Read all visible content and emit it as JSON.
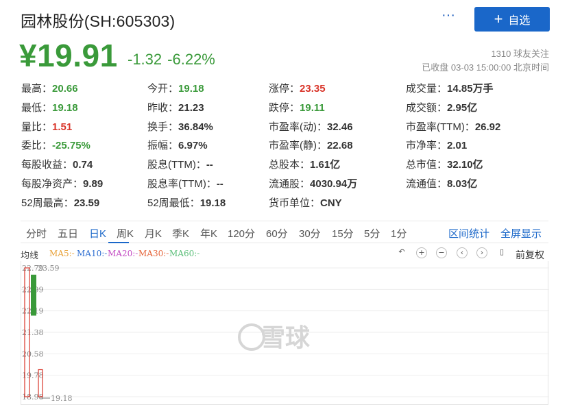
{
  "header": {
    "title": "园林股份(SH:605303)",
    "more_label": "···",
    "follow_label": "自选",
    "follow_plus": "+"
  },
  "quote": {
    "price": "¥19.91",
    "change": "-1.32",
    "change_pct": "-6.22%",
    "followers": "1310 球友关注",
    "status": "已收盘 03-03 15:00:00 北京时间"
  },
  "stats": [
    [
      {
        "label": "最高：",
        "value": "20.66",
        "color": "green"
      },
      {
        "label": "今开：",
        "value": "19.18",
        "color": "green"
      },
      {
        "label": "涨停：",
        "value": "23.35",
        "color": "red"
      },
      {
        "label": "成交量：",
        "value": "14.85万手",
        "color": "dark"
      }
    ],
    [
      {
        "label": "最低：",
        "value": "19.18",
        "color": "green"
      },
      {
        "label": "昨收：",
        "value": "21.23",
        "color": "dark"
      },
      {
        "label": "跌停：",
        "value": "19.11",
        "color": "green"
      },
      {
        "label": "成交额：",
        "value": "2.95亿",
        "color": "dark"
      }
    ],
    [
      {
        "label": "量比：",
        "value": "1.51",
        "color": "red"
      },
      {
        "label": "换手：",
        "value": "36.84%",
        "color": "dark"
      },
      {
        "label": "市盈率(动)：",
        "value": "32.46",
        "color": "dark"
      },
      {
        "label": "市盈率(TTM)：",
        "value": "26.92",
        "color": "dark"
      }
    ],
    [
      {
        "label": "委比：",
        "value": "-25.75%",
        "color": "green"
      },
      {
        "label": "振幅：",
        "value": "6.97%",
        "color": "dark"
      },
      {
        "label": "市盈率(静)：",
        "value": "22.68",
        "color": "dark"
      },
      {
        "label": "市净率：",
        "value": "2.01",
        "color": "dark"
      }
    ],
    [
      {
        "label": "每股收益：",
        "value": "0.74",
        "color": "dark"
      },
      {
        "label": "股息(TTM)：",
        "value": "--",
        "color": "dark"
      },
      {
        "label": "总股本：",
        "value": "1.61亿",
        "color": "dark"
      },
      {
        "label": "总市值：",
        "value": "32.10亿",
        "color": "dark"
      }
    ],
    [
      {
        "label": "每股净资产：",
        "value": "9.89",
        "color": "dark"
      },
      {
        "label": "股息率(TTM)：",
        "value": "--",
        "color": "dark"
      },
      {
        "label": "流通股：",
        "value": "4030.94万",
        "color": "dark"
      },
      {
        "label": "流通值：",
        "value": "8.03亿",
        "color": "dark"
      }
    ],
    [
      {
        "label": "52周最高：",
        "value": "23.59",
        "color": "dark"
      },
      {
        "label": "52周最低：",
        "value": "19.18",
        "color": "dark"
      },
      {
        "label": "货币单位：",
        "value": "CNY",
        "color": "dark"
      }
    ]
  ],
  "tabs": [
    "分时",
    "五日",
    "日K",
    "周K",
    "月K",
    "季K",
    "年K",
    "120分",
    "60分",
    "30分",
    "15分",
    "5分",
    "1分"
  ],
  "active_tab": "日K",
  "tab_actions": [
    "区间统计",
    "全屏显示"
  ],
  "ma_bar": {
    "label": "均线",
    "items": [
      {
        "text": "MA5:-",
        "color": "#e8a23a"
      },
      {
        "text": "MA10:-",
        "color": "#2f6fd1"
      },
      {
        "text": "MA20:-",
        "color": "#c34bc3"
      },
      {
        "text": "MA30:-",
        "color": "#e5653b"
      },
      {
        "text": "MA60:-",
        "color": "#5cbf7a"
      }
    ],
    "controls": [
      {
        "name": "undo-icon",
        "glyph": "↶"
      },
      {
        "name": "zoom-in-icon",
        "glyph": "+"
      },
      {
        "name": "zoom-out-icon",
        "glyph": "−"
      },
      {
        "name": "pan-left-icon",
        "glyph": "‹"
      },
      {
        "name": "pan-right-icon",
        "glyph": "›"
      },
      {
        "name": "pin-icon",
        "glyph": "▯"
      }
    ],
    "fuquan_label": "前复权"
  },
  "chart_data": {
    "type": "candlestick",
    "y_ticks": [
      "22.79",
      "22.99",
      "22.19",
      "21.38",
      "20.58",
      "19.78",
      "18.98"
    ],
    "high_annotation": "23.59",
    "low_annotation": "19.18",
    "watermark": "雪球",
    "ylim": [
      18.98,
      22.79
    ],
    "candles": [
      {
        "open": 22.79,
        "close": 18.98,
        "high": 22.79,
        "low": 18.98,
        "direction": "down",
        "style": "outline"
      },
      {
        "open": 21.38,
        "close": 22.59,
        "high": 22.59,
        "low": 21.38,
        "direction": "up",
        "style": "filled"
      },
      {
        "open": 19.78,
        "close": 18.98,
        "high": 19.78,
        "low": 18.98,
        "direction": "down",
        "style": "outline"
      }
    ],
    "colors": {
      "up": "#3a9a3a",
      "down": "#d9352a",
      "grid": "#eeeeee",
      "tick": "#888888"
    }
  }
}
